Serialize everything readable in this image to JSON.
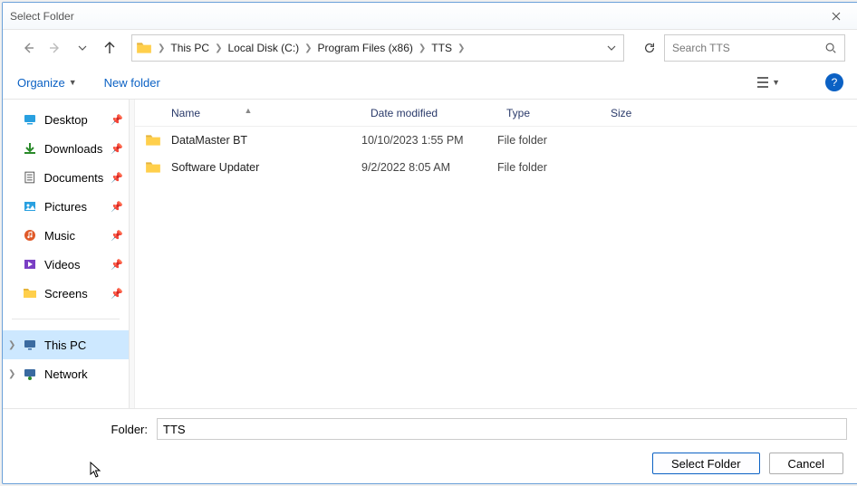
{
  "title": "Select Folder",
  "breadcrumb": [
    "This PC",
    "Local Disk (C:)",
    "Program Files (x86)",
    "TTS"
  ],
  "search_placeholder": "Search TTS",
  "toolbar": {
    "organize": "Organize",
    "new_folder": "New folder"
  },
  "columns": {
    "name": "Name",
    "date": "Date modified",
    "type": "Type",
    "size": "Size"
  },
  "sidebar": {
    "quick": [
      {
        "label": "Desktop",
        "icon": "desktop",
        "pinned": true
      },
      {
        "label": "Downloads",
        "icon": "downloads",
        "pinned": true
      },
      {
        "label": "Documents",
        "icon": "documents",
        "pinned": true
      },
      {
        "label": "Pictures",
        "icon": "pictures",
        "pinned": true
      },
      {
        "label": "Music",
        "icon": "music",
        "pinned": true
      },
      {
        "label": "Videos",
        "icon": "videos",
        "pinned": true
      },
      {
        "label": "Screens",
        "icon": "folder",
        "pinned": true
      }
    ],
    "system": [
      {
        "label": "This PC",
        "icon": "pc",
        "selected": true,
        "expand": true
      },
      {
        "label": "Network",
        "icon": "network",
        "expand": true
      }
    ]
  },
  "files": [
    {
      "name": "DataMaster BT",
      "date": "10/10/2023 1:55 PM",
      "type": "File folder",
      "size": ""
    },
    {
      "name": "Software Updater",
      "date": "9/2/2022 8:05 AM",
      "type": "File folder",
      "size": ""
    }
  ],
  "footer": {
    "folder_label": "Folder:",
    "folder_value": "TTS",
    "select_btn": "Select Folder",
    "cancel_btn": "Cancel"
  }
}
